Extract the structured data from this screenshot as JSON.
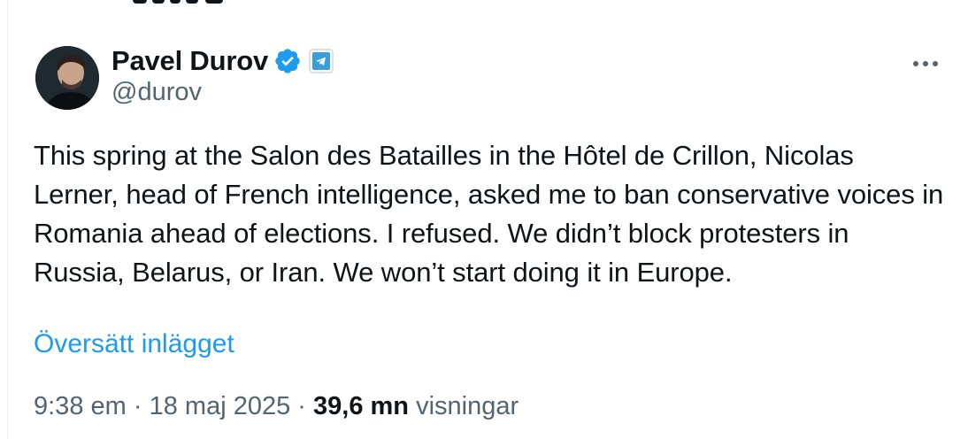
{
  "author": {
    "display_name": "Pavel Durov",
    "handle": "@durov",
    "verified_badge_icon": "verified-checkmark-icon",
    "affiliation_icon": "telegram-icon"
  },
  "tweet": {
    "text": "This spring at the Salon des Batailles in the Hôtel de Crillon, Nicolas Lerner, head of French intelligence, asked me to ban conservative voices in Romania ahead of elections. I refused. We didn’t block protesters in Russia, Belarus, or Iran. We won’t start doing it in Europe.",
    "translate_label": "Översätt inlägget"
  },
  "meta": {
    "time": "9:38 em",
    "separator": "·",
    "date": "18 maj 2025",
    "views_count": "39,6 mn",
    "views_label": "visningar"
  },
  "colors": {
    "text": "#0f1419",
    "secondary": "#536471",
    "link": "#1d9bf0",
    "verified": "#1d9bf0"
  }
}
